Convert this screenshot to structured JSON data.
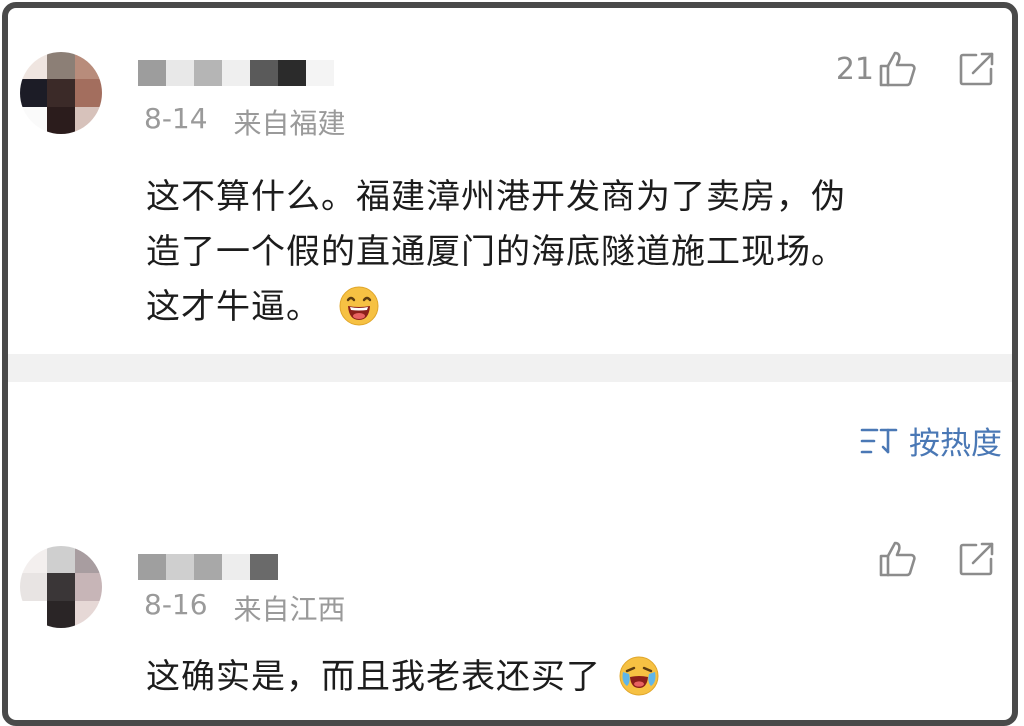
{
  "comments": [
    {
      "date": "8-14",
      "location": "来自福建",
      "like_count": "21",
      "lines": [
        "这不算什么。福建漳州港开发商为了卖房，伪",
        "造了一个假的直通厦门的海底隧道施工现场。",
        "这才牛逼。"
      ],
      "emoji": "laughing-emoji"
    },
    {
      "date": "8-16",
      "location": "来自江西",
      "like_count": "",
      "lines": [
        "这确实是，而且我老表还买了"
      ],
      "emoji": "crying-laughing-emoji"
    }
  ],
  "sort": {
    "label": "按热度",
    "icon": "sort-icon"
  },
  "icons": {
    "like": "thumbs-up-icon",
    "share": "share-icon"
  },
  "colors": {
    "accent": "#4a78b5",
    "meta": "#9a9a9a",
    "text": "#1c1c1c"
  }
}
